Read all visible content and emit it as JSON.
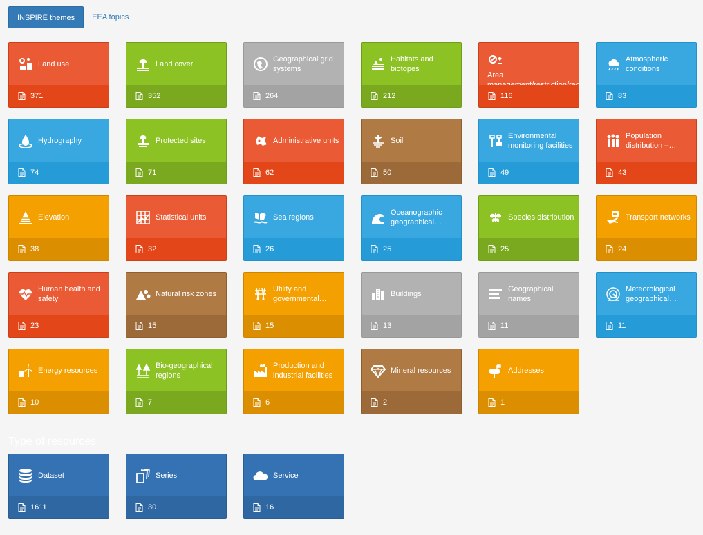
{
  "tabs": [
    {
      "label": "INSPIRE themes",
      "active": true
    },
    {
      "label": "EEA topics",
      "active": false
    }
  ],
  "themes": [
    {
      "label": "Land use",
      "count": "371",
      "color": "red",
      "icon": "land-use-icon"
    },
    {
      "label": "Land cover",
      "count": "352",
      "color": "green",
      "icon": "land-cover-icon"
    },
    {
      "label": "Geographical grid systems",
      "count": "264",
      "color": "grey",
      "icon": "grid-globe-icon"
    },
    {
      "label": "Habitats and biotopes",
      "count": "212",
      "color": "green",
      "icon": "habitat-icon"
    },
    {
      "label": "Area management/restriction/regulation zones and reporting units",
      "count": "116",
      "color": "red",
      "icon": "restriction-icon"
    },
    {
      "label": "Atmospheric conditions",
      "count": "83",
      "color": "blue",
      "icon": "cloud-rain-icon"
    },
    {
      "label": "Hydrography",
      "count": "74",
      "color": "blue",
      "icon": "water-drop-icon"
    },
    {
      "label": "Protected sites",
      "count": "71",
      "color": "green",
      "icon": "protected-sites-icon"
    },
    {
      "label": "Administrative units",
      "count": "62",
      "color": "red",
      "icon": "admin-units-icon"
    },
    {
      "label": "Soil",
      "count": "50",
      "color": "brown",
      "icon": "soil-icon"
    },
    {
      "label": "Environmental monitoring facilities",
      "count": "49",
      "color": "blue",
      "icon": "monitoring-icon"
    },
    {
      "label": "Population distribution – demography",
      "count": "43",
      "color": "red",
      "icon": "population-icon"
    },
    {
      "label": "Elevation",
      "count": "38",
      "color": "orange",
      "icon": "elevation-icon"
    },
    {
      "label": "Statistical units",
      "count": "32",
      "color": "red",
      "icon": "statistical-grid-icon"
    },
    {
      "label": "Sea regions",
      "count": "26",
      "color": "blue",
      "icon": "sea-regions-icon"
    },
    {
      "label": "Oceanographic geographical features",
      "count": "25",
      "color": "blue",
      "icon": "wave-icon"
    },
    {
      "label": "Species distribution",
      "count": "25",
      "color": "green",
      "icon": "species-icon"
    },
    {
      "label": "Transport networks",
      "count": "24",
      "color": "orange",
      "icon": "transport-icon"
    },
    {
      "label": "Human health and safety",
      "count": "23",
      "color": "red",
      "icon": "heart-pulse-icon"
    },
    {
      "label": "Natural risk zones",
      "count": "15",
      "color": "brown",
      "icon": "risk-zones-icon"
    },
    {
      "label": "Utility and governmental services",
      "count": "15",
      "color": "orange",
      "icon": "utility-towers-icon"
    },
    {
      "label": "Buildings",
      "count": "13",
      "color": "grey",
      "icon": "buildings-icon"
    },
    {
      "label": "Geographical names",
      "count": "11",
      "color": "grey",
      "icon": "geographical-names-icon"
    },
    {
      "label": "Meteorological geographical features",
      "count": "11",
      "color": "blue",
      "icon": "radar-icon"
    },
    {
      "label": "Energy resources",
      "count": "10",
      "color": "orange",
      "icon": "wind-turbine-icon"
    },
    {
      "label": "Bio-geographical regions",
      "count": "7",
      "color": "green",
      "icon": "bio-regions-icon"
    },
    {
      "label": "Production and industrial facilities",
      "count": "6",
      "color": "orange",
      "icon": "factory-icon"
    },
    {
      "label": "Mineral resources",
      "count": "2",
      "color": "brown",
      "icon": "diamond-icon"
    },
    {
      "label": "Addresses",
      "count": "1",
      "color": "orange",
      "icon": "mailbox-icon"
    }
  ],
  "types_section": {
    "title": "Type of resources",
    "items": [
      {
        "label": "Dataset",
        "count": "1611",
        "color": "dblue",
        "icon": "database-icon"
      },
      {
        "label": "Series",
        "count": "30",
        "color": "dblue",
        "icon": "series-icon"
      },
      {
        "label": "Service",
        "count": "16",
        "color": "dblue",
        "icon": "cloud-icon"
      }
    ]
  }
}
